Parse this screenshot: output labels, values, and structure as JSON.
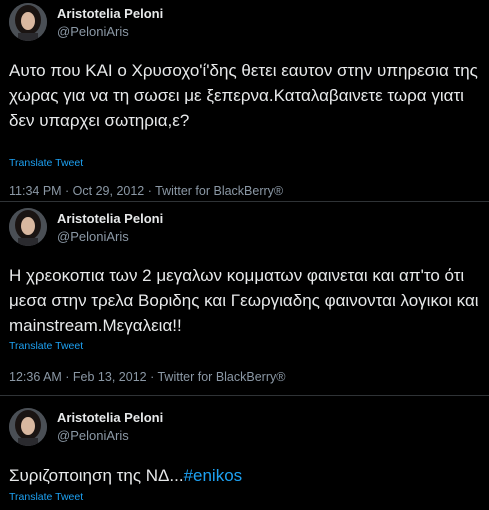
{
  "tweets": [
    {
      "author_name": "Aristotelia Peloni",
      "author_handle": "@PeloniAris",
      "text": "Αυτο που ΚΑΙ ο Χρυσοχο'ί'δης θετει εαυτον στην υπηρεσια της χωρας για να τη σωσει με ξεπερνα.Καταλαβαινετε τωρα γιατι δεν υπαρχει σωτηρια,ε?",
      "translate_label": "Translate Tweet",
      "timestamp": "11:34 PM · Oct 29, 2012 · Twitter for BlackBerry®"
    },
    {
      "author_name": "Aristotelia Peloni",
      "author_handle": "@PeloniAris",
      "text": "Η χρεοκοπια των 2 μεγαλων κομματων φαινεται και απ'το ότι μεσα στην τρελα Βοριδης και Γεωργιαδης φαινονται λογικοι και mainstream.Μεγαλεια!!",
      "translate_label": "Translate Tweet",
      "timestamp": "12:36 AM · Feb 13, 2012 · Twitter for BlackBerry®"
    },
    {
      "author_name": "Aristotelia Peloni",
      "author_handle": "@PeloniAris",
      "text": "Συριζοποιηση της ΝΔ...",
      "hashtag": "#enikos",
      "translate_label": "Translate Tweet"
    }
  ],
  "colors": {
    "background": "#000000",
    "text": "#e7e9ea",
    "secondary": "#8b98a5",
    "link": "#1da1f2",
    "separator": "#2f3336"
  },
  "icons": {
    "avatar": "profile-photo"
  }
}
